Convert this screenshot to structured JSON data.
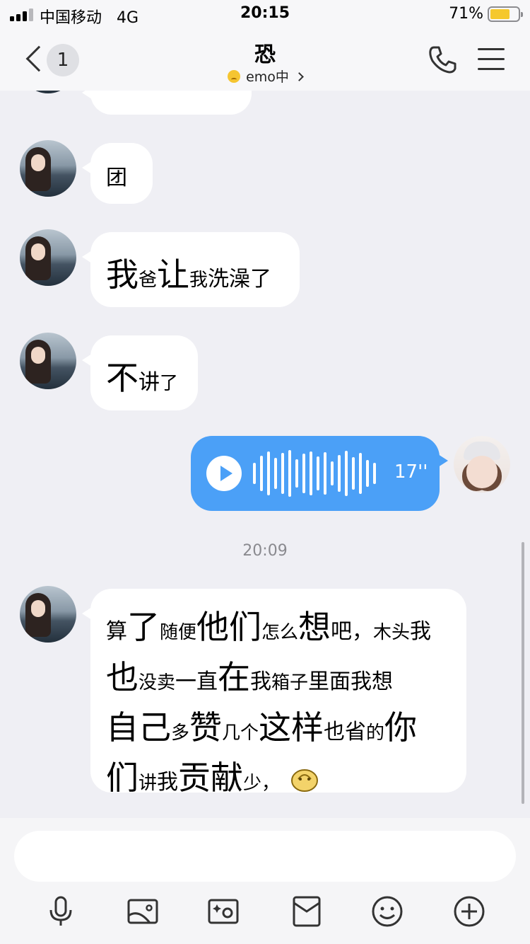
{
  "status_bar": {
    "carrier": "中国移动",
    "network": "4G",
    "time": "20:15",
    "battery_percent": "71%",
    "battery_level": 0.71
  },
  "header": {
    "unread_count": "1",
    "contact_name": "恐",
    "status_text": "emo中"
  },
  "messages": [
    {
      "sender": "friend",
      "segments": [
        {
          "text": "团",
          "size": "mid"
        }
      ]
    },
    {
      "sender": "friend",
      "segments": [
        {
          "text": "我",
          "size": "big"
        },
        {
          "text": "爸",
          "size": "small"
        },
        {
          "text": "让",
          "size": "big"
        },
        {
          "text": "我",
          "size": "small"
        },
        {
          "text": "洗澡了",
          "size": "mid"
        }
      ]
    },
    {
      "sender": "friend",
      "segments": [
        {
          "text": "不",
          "size": "big"
        },
        {
          "text": "讲",
          "size": "mid"
        },
        {
          "text": "了",
          "size": "small"
        }
      ]
    },
    {
      "sender": "me",
      "type": "voice",
      "duration": "17''"
    },
    {
      "sender": "friend",
      "lines": [
        [
          {
            "text": "算",
            "size": "mid"
          },
          {
            "text": "了",
            "size": "big"
          },
          {
            "text": "随便",
            "size": "small"
          },
          {
            "text": "他们",
            "size": "big"
          },
          {
            "text": "怎么",
            "size": "small"
          },
          {
            "text": "想",
            "size": "big"
          },
          {
            "text": "吧，",
            "size": "mid"
          },
          {
            "text": "木头",
            "size": "small"
          },
          {
            "text": "我",
            "size": "mid"
          }
        ],
        [
          {
            "text": "也",
            "size": "big"
          },
          {
            "text": "没卖",
            "size": "small"
          },
          {
            "text": "一直",
            "size": "mid"
          },
          {
            "text": "在",
            "size": "big"
          },
          {
            "text": "我",
            "size": "mid"
          },
          {
            "text": "箱子",
            "size": "small"
          },
          {
            "text": "里面我想",
            "size": "mid"
          }
        ],
        [
          {
            "text": "自己",
            "size": "big"
          },
          {
            "text": "多",
            "size": "small"
          },
          {
            "text": "赞",
            "size": "big"
          },
          {
            "text": "几个",
            "size": "small"
          },
          {
            "text": "这样",
            "size": "big"
          },
          {
            "text": "也省",
            "size": "mid"
          },
          {
            "text": "的",
            "size": "small"
          },
          {
            "text": "你",
            "size": "big"
          }
        ],
        [
          {
            "text": "们",
            "size": "big"
          },
          {
            "text": "讲",
            "size": "small"
          },
          {
            "text": "我",
            "size": "mid"
          },
          {
            "text": "贡献",
            "size": "big"
          },
          {
            "text": "少，",
            "size": "small"
          }
        ]
      ],
      "trailing_emoji": "sad-face"
    }
  ],
  "timestamp": "20:09",
  "input": {
    "placeholder": ""
  },
  "toolbar": [
    "microphone-icon",
    "image-icon",
    "camera-icon",
    "red-envelope-icon",
    "emoji-icon",
    "plus-icon"
  ],
  "colors": {
    "background": "#efeff4",
    "voice_bubble": "#4ba0f7",
    "bubble": "#ffffff",
    "battery_fill": "#f5c82c"
  }
}
